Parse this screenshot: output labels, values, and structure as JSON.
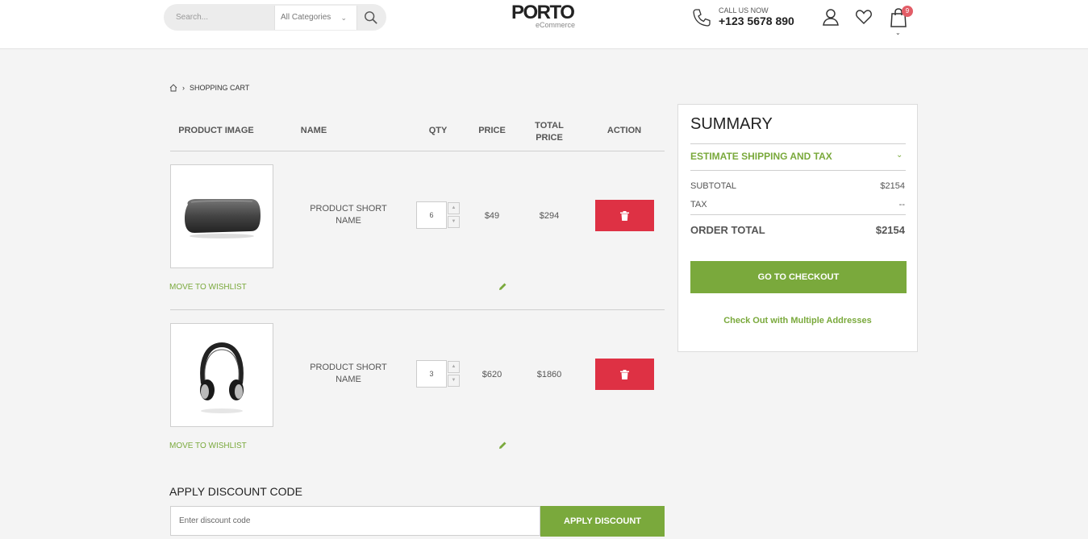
{
  "header": {
    "search_placeholder": "Search...",
    "category_label": "All Categories",
    "logo_main": "PORTO",
    "logo_sub": "eCommerce",
    "call_label": "CALL US NOW",
    "call_number": "+123 5678 890",
    "cart_count": "9"
  },
  "breadcrumb": {
    "current": "SHOPPING CART"
  },
  "table": {
    "headers": {
      "image": "PRODUCT IMAGE",
      "name": "NAME",
      "qty": "QTY",
      "price": "PRICE",
      "total_line1": "TOTAL",
      "total_line2": "PRICE",
      "action": "ACTION"
    },
    "rows": [
      {
        "name_line1": "PRODUCT SHORT",
        "name_line2": "NAME",
        "qty": "6",
        "price": "$49",
        "total": "$294",
        "wishlist": "MOVE TO WISHLIST",
        "image_icon": "speaker-image"
      },
      {
        "name_line1": "PRODUCT SHORT",
        "name_line2": "NAME",
        "qty": "3",
        "price": "$620",
        "total": "$1860",
        "wishlist": "MOVE TO WISHLIST",
        "image_icon": "headphones-image"
      }
    ]
  },
  "discount": {
    "title": "APPLY DISCOUNT CODE",
    "placeholder": "Enter discount code",
    "button": "APPLY DISCOUNT"
  },
  "summary": {
    "title": "SUMMARY",
    "estimate_label": "ESTIMATE SHIPPING AND TAX",
    "subtotal_label": "SUBTOTAL",
    "subtotal_value": "$2154",
    "tax_label": "TAX",
    "tax_value": "--",
    "order_total_label": "ORDER TOTAL",
    "order_total_value": "$2154",
    "checkout_button": "GO TO CHECKOUT",
    "multi_address_link": "Check Out with Multiple Addresses"
  },
  "colors": {
    "accent_green": "#7aa93c",
    "delete_red": "#de3144",
    "badge_red": "#e25d67"
  }
}
